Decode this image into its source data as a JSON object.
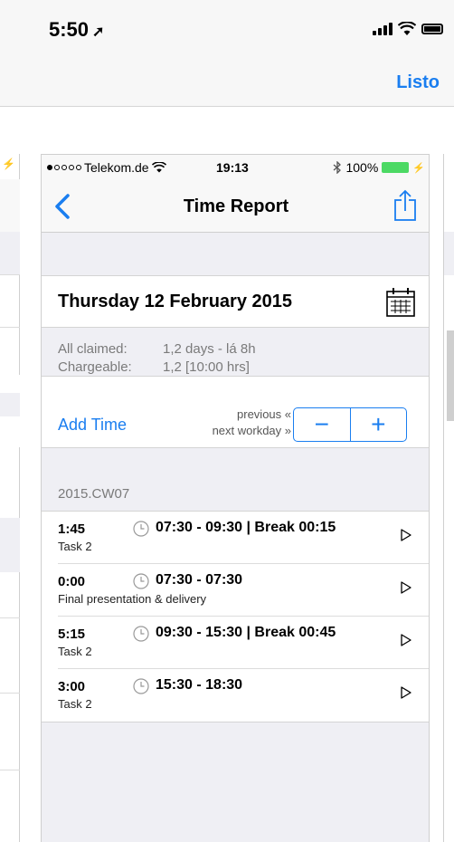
{
  "outer_status": {
    "time": "5:50",
    "location_arrow": "➚"
  },
  "outer_nav": {
    "done_label": "Listo"
  },
  "device_status": {
    "carrier": "Telekom.de",
    "time": "19:13",
    "battery_percent": "100%"
  },
  "nav": {
    "title": "Time Report"
  },
  "date": {
    "label": "Thursday 12 February 2015"
  },
  "summary": {
    "all_claimed_label": "All claimed:",
    "all_claimed_value": "1,2 days - lá 8h",
    "chargeable_label": "Chargeable:",
    "chargeable_value": "1,2 [10:00 hrs]"
  },
  "controls": {
    "add_time_label": "Add Time",
    "previous_label": "previous «",
    "next_label": "next workday »",
    "minus_label": "−",
    "plus_label": "+"
  },
  "section": {
    "title": "2015.CW07"
  },
  "entries": [
    {
      "duration": "1:45",
      "range": "07:30 - 09:30 | Break 00:15",
      "task": "Task 2"
    },
    {
      "duration": "0:00",
      "range": "07:30 - 07:30",
      "task": "Final presentation & delivery"
    },
    {
      "duration": "5:15",
      "range": "09:30 - 15:30 | Break 00:45",
      "task": "Task 2"
    },
    {
      "duration": "3:00",
      "range": "15:30 - 18:30",
      "task": "Task 2"
    }
  ],
  "icons": {
    "back": "chevron-left-icon",
    "share": "share-icon",
    "calendar": "calendar-icon",
    "clock": "clock-icon",
    "play": "play-icon",
    "wifi": "wifi-icon",
    "bluetooth": "bluetooth-icon",
    "battery": "battery-icon"
  },
  "colors": {
    "accent": "#1a7ef0",
    "battery_green": "#4cd964",
    "background": "#efeff4"
  }
}
